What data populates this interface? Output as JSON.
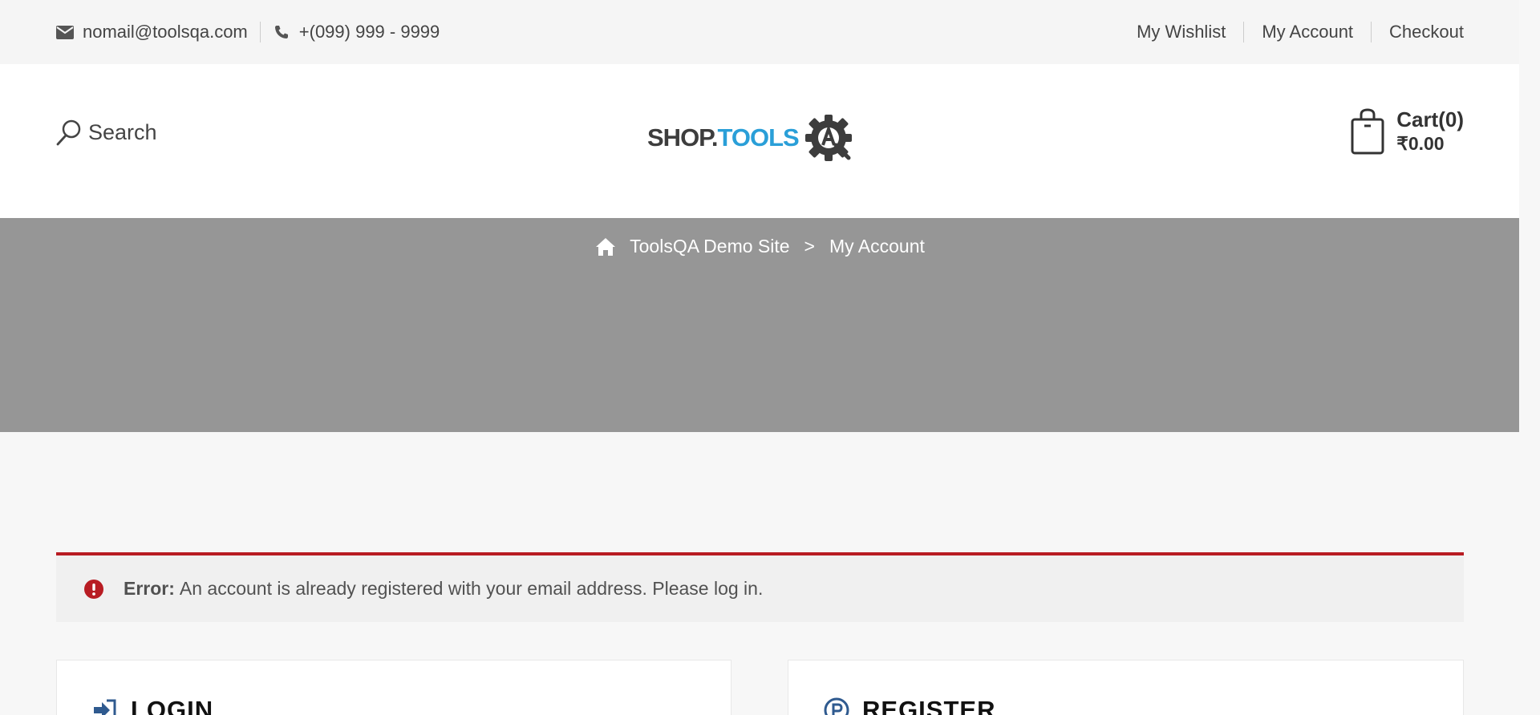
{
  "topbar": {
    "email": "nomail@toolsqa.com",
    "phone": "+(099) 999 - 9999",
    "links": [
      "My Wishlist",
      "My Account",
      "Checkout"
    ]
  },
  "header": {
    "search_label": "Search",
    "logo": {
      "shop": "SHOP.",
      "tools": "TOOLS"
    },
    "cart_label": "Cart(0)",
    "cart_amount": "₹0.00"
  },
  "breadcrumb": {
    "site": "ToolsQA Demo Site",
    "separator": ">",
    "current": "My Account"
  },
  "error": {
    "label": "Error:",
    "message": "An account is already registered with your email address. Please log in."
  },
  "panels": {
    "login_title": "LOGIN",
    "register_title": "REGISTER"
  },
  "colors": {
    "accent": "#b81c23",
    "logo_blue": "#2a9fd8",
    "banner": "#969696",
    "icon_blue": "#2f5a8f"
  }
}
